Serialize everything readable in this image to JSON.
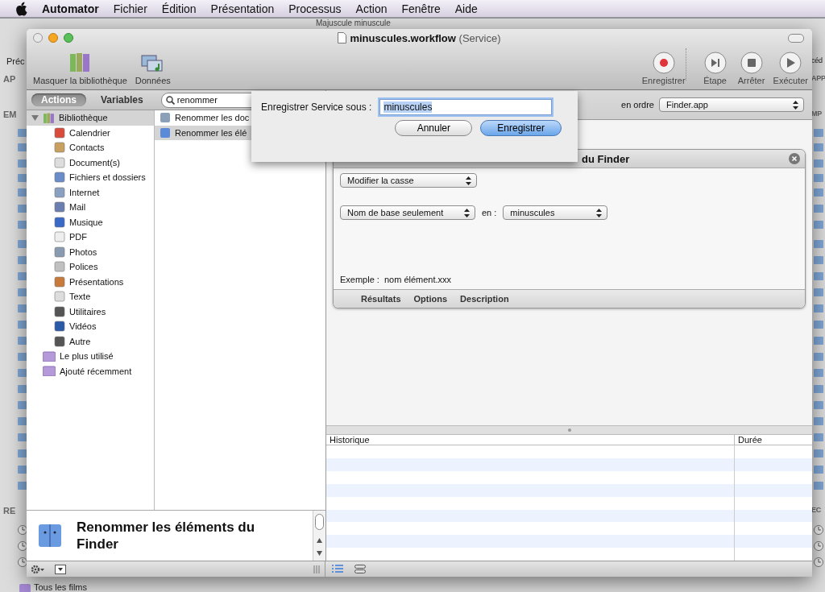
{
  "menubar": {
    "app": "Automator",
    "menus": [
      "Fichier",
      "Édition",
      "Présentation",
      "Processus",
      "Action",
      "Fenêtre",
      "Aide"
    ]
  },
  "background_window": {
    "title": "Majuscule minuscule",
    "left_edge": [
      "Préc",
      "AP",
      "EM",
      "RE"
    ],
    "right_edge": [
      "céd",
      "APP",
      "MP",
      "EC"
    ],
    "bottom_item": "Tous les films"
  },
  "window": {
    "title": "minuscules.workflow",
    "subtitle": "(Service)"
  },
  "toolbar": {
    "left": [
      {
        "label": "Masquer la bibliothèque",
        "kind": "library"
      },
      {
        "label": "Données",
        "kind": "media"
      }
    ],
    "right": [
      {
        "label": "Enregistrer",
        "kind": "record"
      },
      {
        "label": "Étape",
        "kind": "step"
      },
      {
        "label": "Arrêter",
        "kind": "stop"
      },
      {
        "label": "Exécuter",
        "kind": "run"
      }
    ]
  },
  "library_tabs": [
    {
      "label": "Actions",
      "selected": true
    },
    {
      "label": "Variables",
      "selected": false
    }
  ],
  "search": {
    "value": "renommer"
  },
  "library": [
    {
      "label": "Bibliothèque",
      "selected": true,
      "expanded": true,
      "children": [
        {
          "label": "Calendrier",
          "selected": false
        },
        {
          "label": "Contacts",
          "selected": false
        },
        {
          "label": "Document(s)",
          "selected": false
        },
        {
          "label": "Fichiers et dossiers",
          "selected": false
        },
        {
          "label": "Internet",
          "selected": false
        },
        {
          "label": "Mail",
          "selected": false
        },
        {
          "label": "Musique",
          "selected": false
        },
        {
          "label": "PDF",
          "selected": false
        },
        {
          "label": "Photos",
          "selected": false
        },
        {
          "label": "Polices",
          "selected": false
        },
        {
          "label": "Présentations",
          "selected": false
        },
        {
          "label": "Texte",
          "selected": false
        },
        {
          "label": "Utilitaires",
          "selected": false
        },
        {
          "label": "Vidéos",
          "selected": false
        },
        {
          "label": "Autre",
          "selected": false
        }
      ]
    },
    {
      "label": "Le plus utilisé",
      "selected": false
    },
    {
      "label": "Ajouté récemment",
      "selected": false
    }
  ],
  "actions": [
    {
      "label": "Renommer les doc",
      "selected": false
    },
    {
      "label": "Renommer les élé",
      "selected": true
    }
  ],
  "description": {
    "title": "Renommer les éléments du Finder"
  },
  "workflow_header": {
    "order_label": "en ordre",
    "app_popup": "Finder.app"
  },
  "action_card": {
    "title": "du Finder",
    "case_popup": "Modifier la casse",
    "scope_popup": "Nom de base seulement",
    "to_label": "en :",
    "mode_popup": "minuscules",
    "example_label": "Exemple :",
    "example_value": "nom élément.xxx",
    "tabs": [
      "Résultats",
      "Options",
      "Description"
    ]
  },
  "log": {
    "columns": [
      "Historique",
      "Durée"
    ]
  },
  "sheet": {
    "label": "Enregistrer Service sous :",
    "value": "minuscules",
    "buttons": [
      {
        "label": "Annuler",
        "kind": "cancel"
      },
      {
        "label": "Enregistrer",
        "kind": "default"
      }
    ]
  }
}
